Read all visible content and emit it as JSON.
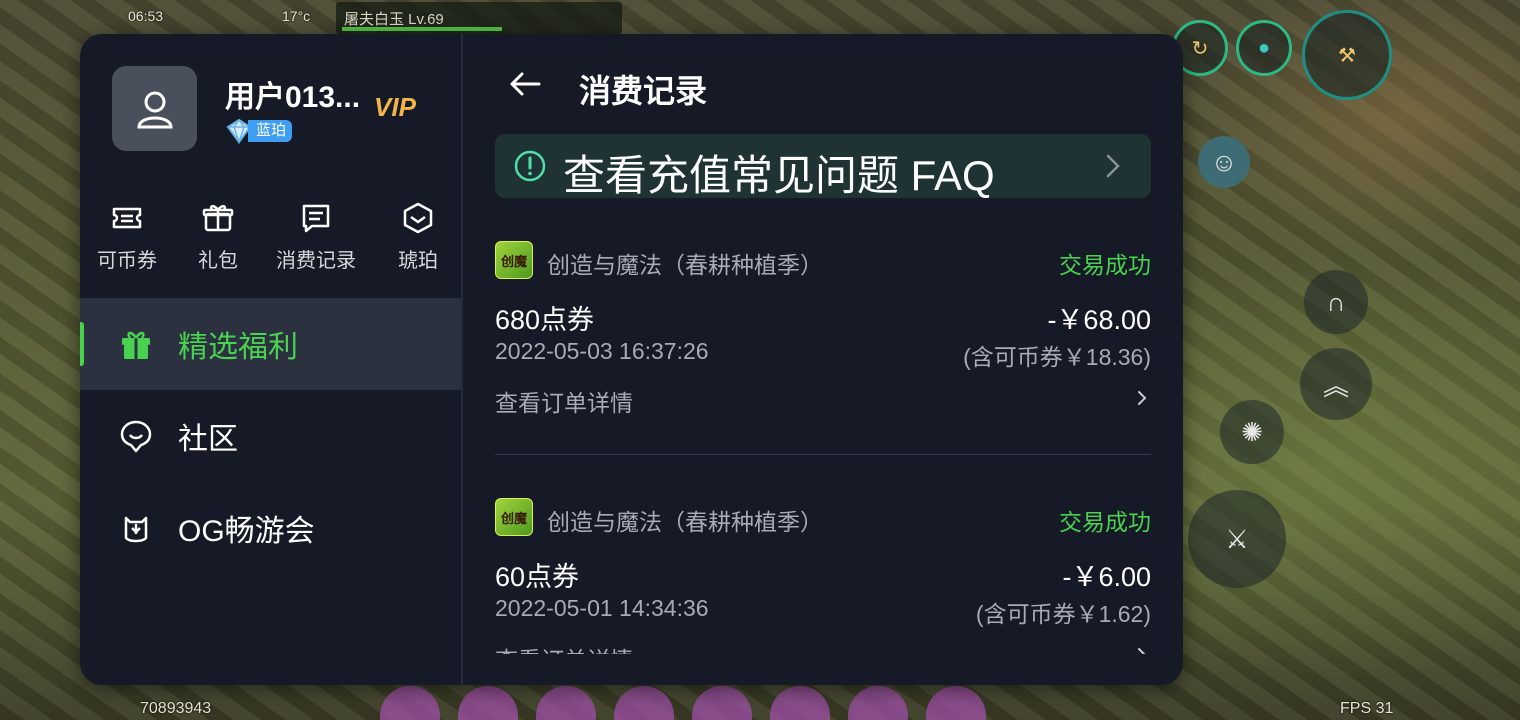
{
  "game_hud": {
    "clock": "06:53",
    "temperature": "17°c",
    "boss_name": "屠夫白玉 Lv.69",
    "player_id": "70893943",
    "fps": "FPS 31"
  },
  "sidebar": {
    "username": "用户013...",
    "vip_label": "VIP",
    "badge_label": "蓝珀",
    "quick_actions": [
      {
        "label": "可币券",
        "icon": "ticket-icon"
      },
      {
        "label": "礼包",
        "icon": "gift-icon"
      },
      {
        "label": "消费记录",
        "icon": "receipt-icon"
      },
      {
        "label": "琥珀",
        "icon": "amber-icon"
      }
    ],
    "nav": [
      {
        "label": "精选福利",
        "icon": "gift-box-icon",
        "active": true
      },
      {
        "label": "社区",
        "icon": "chat-bubble-icon",
        "active": false
      },
      {
        "label": "OG畅游会",
        "icon": "og-club-icon",
        "active": false
      }
    ]
  },
  "content": {
    "title": "消费记录",
    "faq_text": "查看充值常见问题 FAQ",
    "orders": [
      {
        "game_icon_text": "创魔",
        "game_name": "创造与魔法（春耕种植季）",
        "status": "交易成功",
        "item": "680点券",
        "amount": "-￥68.00",
        "time": "2022-05-03 16:37:26",
        "coupon": "(含可币券￥18.36)",
        "detail_label": "查看订单详情"
      },
      {
        "game_icon_text": "创魔",
        "game_name": "创造与魔法（春耕种植季）",
        "status": "交易成功",
        "item": "60点券",
        "amount": "-￥6.00",
        "time": "2022-05-01 14:34:36",
        "coupon": "(含可币券￥1.62)",
        "detail_label": "查看订单详情"
      }
    ]
  },
  "colors": {
    "panel_bg": "#161a26",
    "active_green": "#49d24f",
    "vip_gold": "#f2b54a",
    "faq_bg": "#1f3335",
    "badge_blue": "#3f9df2"
  }
}
